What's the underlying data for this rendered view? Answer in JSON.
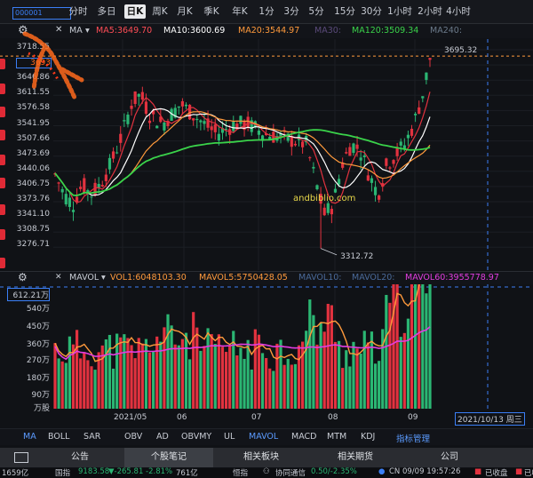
{
  "tabs": {
    "code": "000001",
    "items": [
      "分时",
      "多日",
      "日K",
      "周K",
      "月K",
      "季K",
      "年K",
      "1分",
      "3分",
      "5分",
      "15分",
      "30分",
      "1小时",
      "2小时",
      "4小时"
    ],
    "active": "日K"
  },
  "ma_legend": {
    "ma": "MA",
    "ma5": "MA5:3649.70",
    "ma10": "MA10:3600.69",
    "ma20": "MA20:3544.97",
    "ma30": "MA30:",
    "ma120": "MA120:3509.34",
    "ma240": "MA240:"
  },
  "price_axis": [
    "3718.55",
    "3693",
    "3646.86",
    "3611.55",
    "3576.58",
    "3541.95",
    "3507.66",
    "3473.69",
    "3440.06",
    "3406.75",
    "3373.76",
    "3341.10",
    "3308.75",
    "3276.71"
  ],
  "price_labels": {
    "high": "3695.32",
    "low": "3312.72"
  },
  "volume_legend": {
    "mavol": "MAVOL",
    "vol1": "VOL1:6048103.30",
    "mavol5": "MAVOL5:5750428.05",
    "mavol10": "MAVOL10:",
    "mavol20": "MAVOL20:",
    "mavol60": "MAVOL60:3955778.97"
  },
  "volume_axis": [
    "612.21万",
    "540万",
    "450万",
    "360万",
    "270万",
    "180万",
    "90万",
    "万股"
  ],
  "x_axis": [
    "2021/05",
    "06",
    "07",
    "08",
    "09"
  ],
  "cursor_date": "2021/10/13 周三",
  "watermark": "andbiblio.com",
  "indicators": [
    "MA",
    "BOLL",
    "SAR",
    "OBV",
    "AD",
    "OBVMY",
    "UL",
    "MAVOL",
    "MACD",
    "MTM",
    "KDJ",
    "指标管理"
  ],
  "bottom_tabs": [
    "公告",
    "个股笔记",
    "相关板块",
    "相关期货",
    "公司"
  ],
  "status": {
    "vol": "1659亿",
    "index_name": "国指",
    "index_value": "9183.58",
    "index_change": "▼-265.81 -2.81%",
    "index_amt": "761亿",
    "name2": "恒指",
    "sync": "协同通信",
    "sync_change": "0.50/-2.35%",
    "clock": "CN 09/09 19:57:26",
    "closed": "已收盘",
    "hk": "已收盘"
  },
  "colors": {
    "up": "#e2323f",
    "down": "#2bb673",
    "ma5": "#e2323f",
    "ma10": "#ffffff",
    "ma20": "#ff9a3c",
    "ma120": "#3ad34a",
    "mavol60": "#e23de0",
    "accent": "#3b7ff6"
  },
  "chart_data": {
    "type": "candlestick",
    "series": [
      {
        "name": "MA5",
        "color": "#e2323f"
      },
      {
        "name": "MA10",
        "color": "#ffffff"
      },
      {
        "name": "MA20",
        "color": "#ff9a3c"
      },
      {
        "name": "MA120",
        "color": "#3ad34a"
      }
    ],
    "ylim": [
      3276.71,
      3718.55
    ],
    "high": 3695.32,
    "low": 3312.72,
    "volume_ylim": [
      0,
      612.21
    ]
  }
}
